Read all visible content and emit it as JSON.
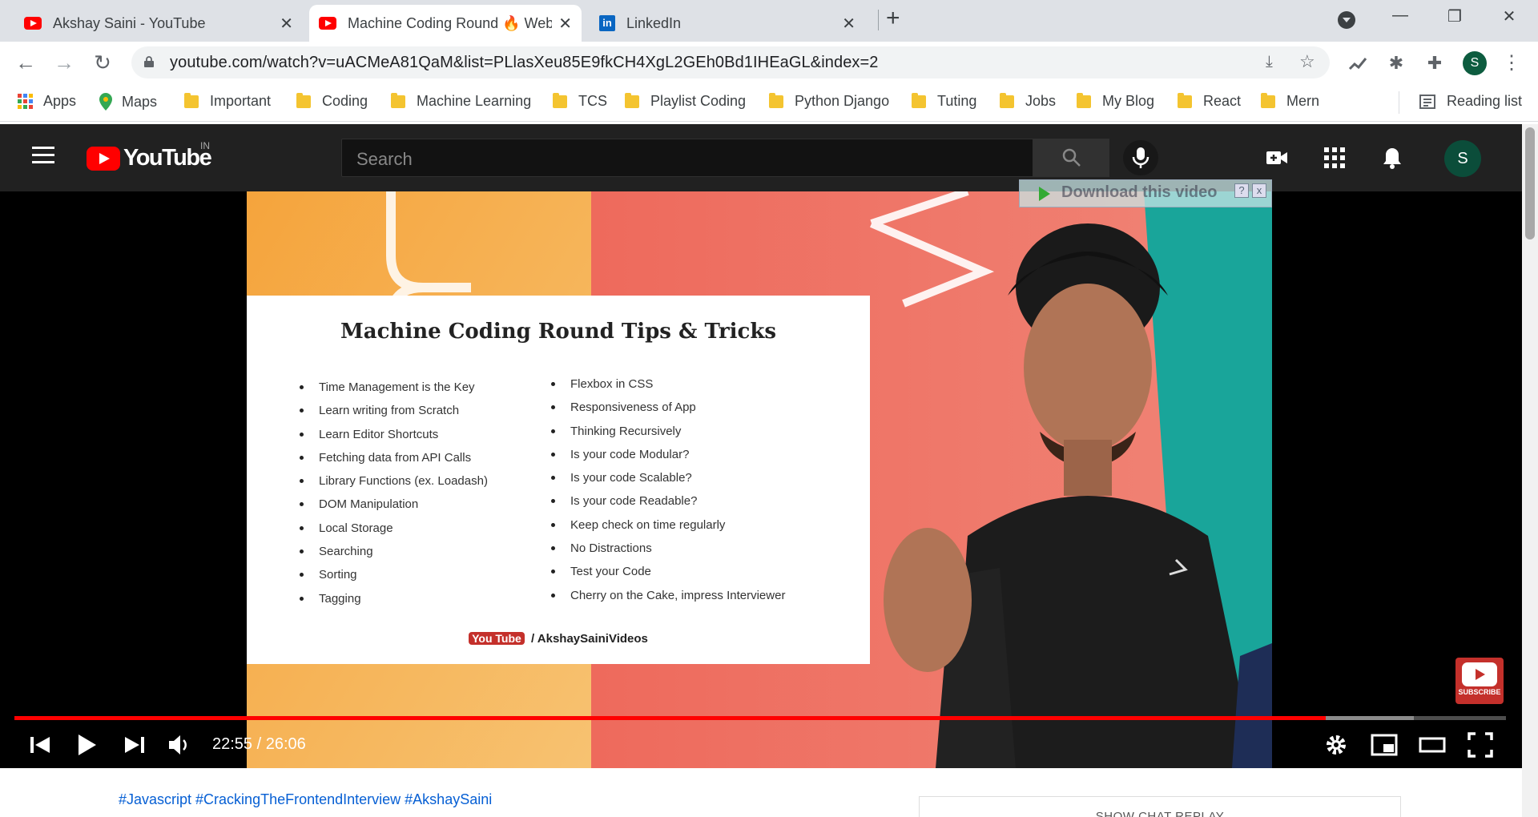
{
  "browser": {
    "tabs": [
      {
        "title": "Akshay Saini - YouTube",
        "icon": "youtube-favicon"
      },
      {
        "title": "Machine Coding Round 🔥 Web",
        "icon": "youtube-favicon",
        "active": true
      },
      {
        "title": "LinkedIn",
        "icon": "linkedin-favicon"
      }
    ],
    "url": "youtube.com/watch?v=uACMeA81QaM&list=PLlasXeu85E9fkCH4XgL2GEh0Bd1IHEaGL&index=2",
    "profile_initial": "S",
    "bookmarks": [
      {
        "label": "Apps",
        "icon": "apps-grid-icon"
      },
      {
        "label": "Maps",
        "icon": "maps-pin-icon"
      },
      {
        "label": "Important",
        "icon": "folder-icon"
      },
      {
        "label": "Coding",
        "icon": "folder-icon"
      },
      {
        "label": "Machine Learning",
        "icon": "folder-icon"
      },
      {
        "label": "TCS",
        "icon": "folder-icon"
      },
      {
        "label": "Playlist Coding",
        "icon": "folder-icon"
      },
      {
        "label": "Python Django",
        "icon": "folder-icon"
      },
      {
        "label": "Tuting",
        "icon": "folder-icon"
      },
      {
        "label": "Jobs",
        "icon": "folder-icon"
      },
      {
        "label": "My Blog",
        "icon": "folder-icon"
      },
      {
        "label": "React",
        "icon": "folder-icon"
      },
      {
        "label": "Mern",
        "icon": "folder-icon"
      }
    ],
    "reading_list": "Reading list"
  },
  "youtube": {
    "logo_text": "YouTube",
    "country_code": "IN",
    "search_placeholder": "Search",
    "avatar_initial": "S"
  },
  "video": {
    "slide_title": "Machine Coding Round  Tips & Tricks",
    "left_points": [
      "Time Management is the Key",
      "Learn writing from Scratch",
      "Learn Editor Shortcuts",
      "Fetching data from API Calls",
      "Library Functions (ex. Loadash)",
      "DOM Manipulation",
      "Local Storage",
      "Searching",
      "Sorting",
      "Tagging"
    ],
    "right_points": [
      "Flexbox in CSS",
      "Responsiveness of App",
      "Thinking Recursively",
      "Is your code Modular?",
      "Is your code Scalable?",
      "Is your code Readable?",
      "Keep check on time regularly",
      "No Distractions",
      "Test your Code",
      "Cherry on the Cake, impress Interviewer"
    ],
    "channel_yt": "You Tube",
    "channel_handle": "/ AkshaySainiVideos",
    "download_overlay": "Download this video",
    "download_help": "?",
    "download_close": "x",
    "subscribe_label": "SUBSCRIBE",
    "time_display": "22:55 / 26:06",
    "progress_fraction": 0.879,
    "buffered_fraction": 0.938,
    "colors": {
      "progress": "#ff0000",
      "slide_left": "#f2a646",
      "slide_right": "#ee6a5c",
      "slide_teal": "#19a59a"
    }
  },
  "below": {
    "hashtags": "#Javascript #CrackingTheFrontendInterview #AkshaySaini",
    "chat_replay": "SHOW CHAT REPLAY"
  }
}
